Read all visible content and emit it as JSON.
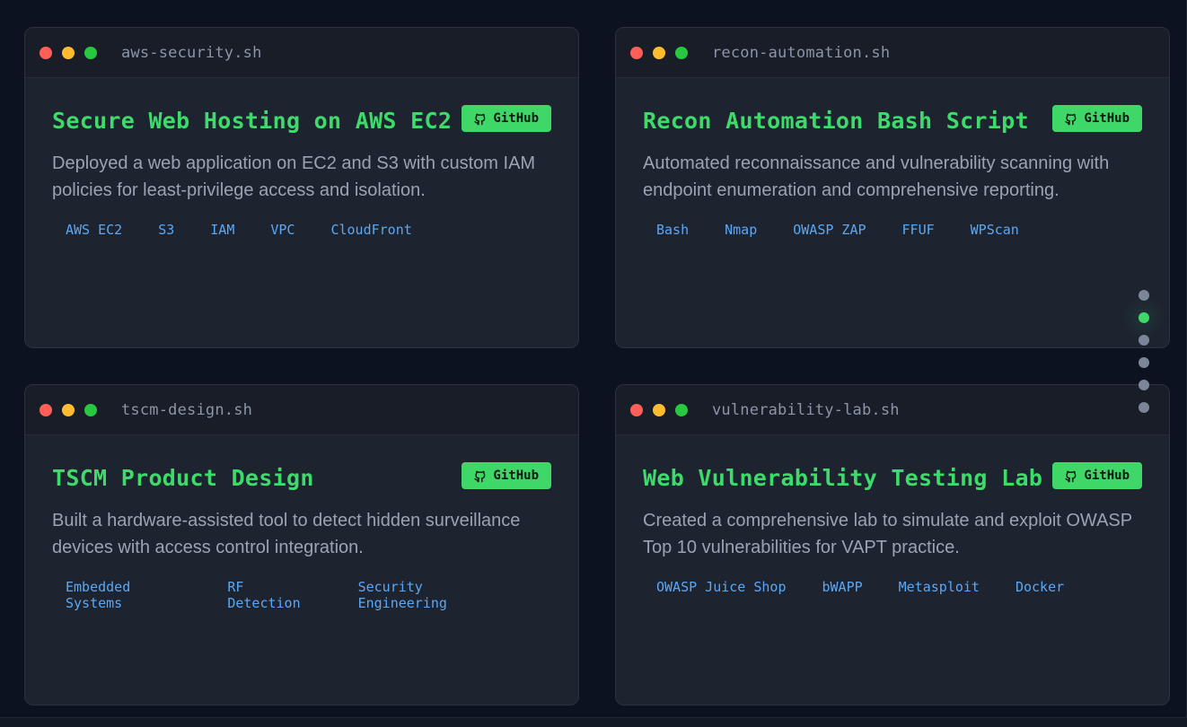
{
  "cards": [
    {
      "filename": "aws-security.sh",
      "title": "Secure Web Hosting on AWS EC2",
      "github_label": "GitHub",
      "description": "Deployed a web application on EC2 and S3 with custom IAM policies for least-privilege access and isolation.",
      "tags": [
        "AWS EC2",
        "S3",
        "IAM",
        "VPC",
        "CloudFront"
      ]
    },
    {
      "filename": "recon-automation.sh",
      "title": "Recon Automation Bash Script",
      "github_label": "GitHub",
      "description": "Automated reconnaissance and vulnerability scanning with endpoint enumeration and comprehensive reporting.",
      "tags": [
        "Bash",
        "Nmap",
        "OWASP ZAP",
        "FFUF",
        "WPScan"
      ]
    },
    {
      "filename": "tscm-design.sh",
      "title": "TSCM Product Design",
      "github_label": "GitHub",
      "description": "Built a hardware-assisted tool to detect hidden surveillance devices with access control integration.",
      "tags": [
        "Embedded Systems",
        "RF Detection",
        "Security Engineering"
      ]
    },
    {
      "filename": "vulnerability-lab.sh",
      "title": "Web Vulnerability Testing Lab",
      "github_label": "GitHub",
      "description": "Created a comprehensive lab to simulate and exploit OWASP Top 10 vulnerabilities for VAPT practice.",
      "tags": [
        "OWASP Juice Shop",
        "bWAPP",
        "Metasploit",
        "Docker"
      ]
    }
  ],
  "nav": {
    "total": 6,
    "active_index": 1
  },
  "colors": {
    "accent": "#3fd768",
    "tag": "#5aa8f5",
    "background": "#0d1220",
    "card": "#1e2330"
  },
  "icons": [
    "github-icon"
  ]
}
